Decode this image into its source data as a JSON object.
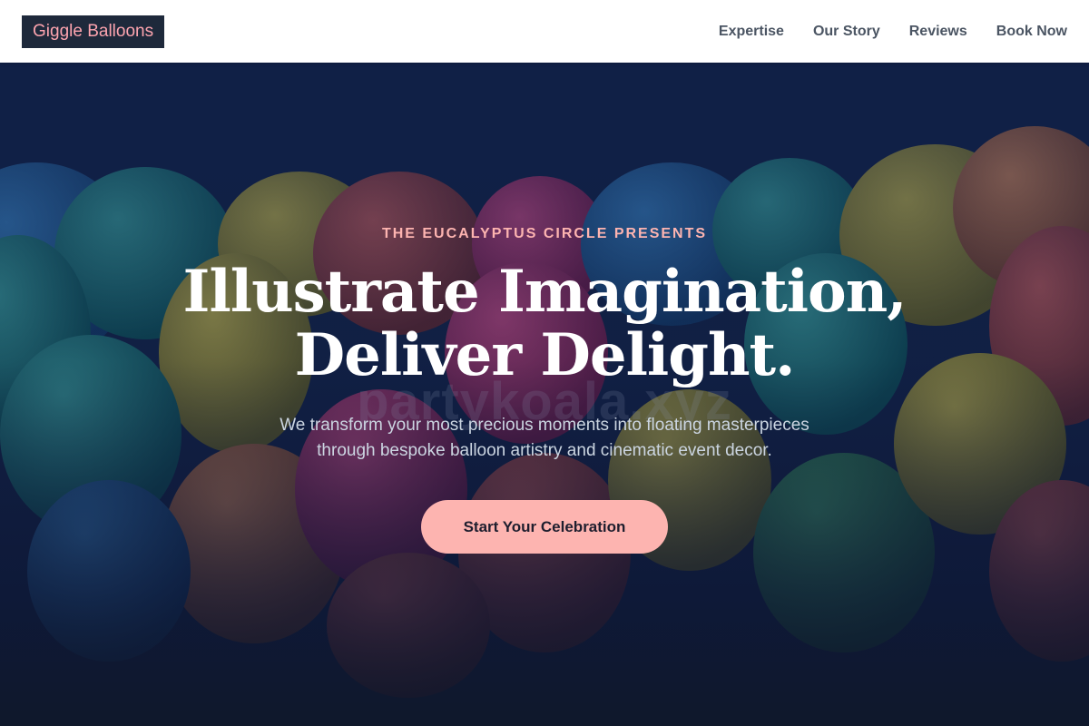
{
  "nav": {
    "logo": "Giggle Balloons",
    "links": [
      "Expertise",
      "Our Story",
      "Reviews",
      "Book Now"
    ]
  },
  "hero": {
    "eyebrow": "THE EUCALYPTUS CIRCLE PRESENTS",
    "headline_line1": "Illustrate Imagination,",
    "headline_line2": "Deliver Delight.",
    "subtext_line1": "We transform your most precious moments into floating masterpieces",
    "subtext_line2": "through bespoke balloon artistry and cinematic event decor.",
    "cta_label": "Start Your Celebration",
    "watermark": "partykoala.xyz"
  },
  "colors": {
    "logo_bg": "#1e293b",
    "logo_text": "#fda4af",
    "accent": "#fdb4b0",
    "hero_bg": "#0f172a"
  }
}
